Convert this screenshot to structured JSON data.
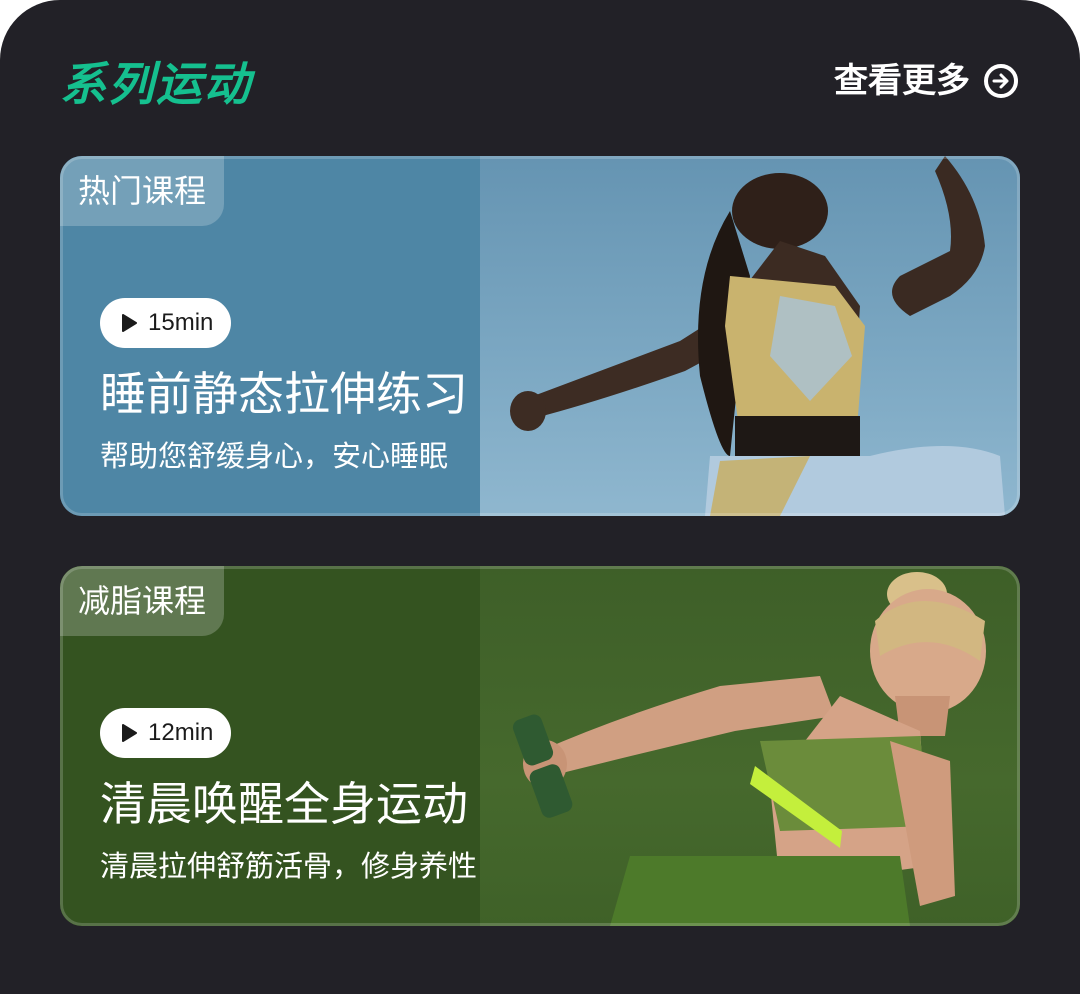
{
  "section": {
    "title": "系列运动",
    "more_label": "查看更多",
    "more_icon": "arrow-circle-right-icon",
    "title_color": "#15c08f",
    "background": "#222127"
  },
  "courses": [
    {
      "tag": "热门课程",
      "duration": "15min",
      "play_icon": "play-icon",
      "title": "睡前静态拉伸练习",
      "subtitle": "帮助您舒缓身心，安心睡眠",
      "theme_color": "#5b8ca9"
    },
    {
      "tag": "减脂课程",
      "duration": "12min",
      "play_icon": "play-icon",
      "title": "清晨唤醒全身运动",
      "subtitle": "清晨拉伸舒筋活骨，修身养性",
      "theme_color": "#3b5a26"
    }
  ]
}
